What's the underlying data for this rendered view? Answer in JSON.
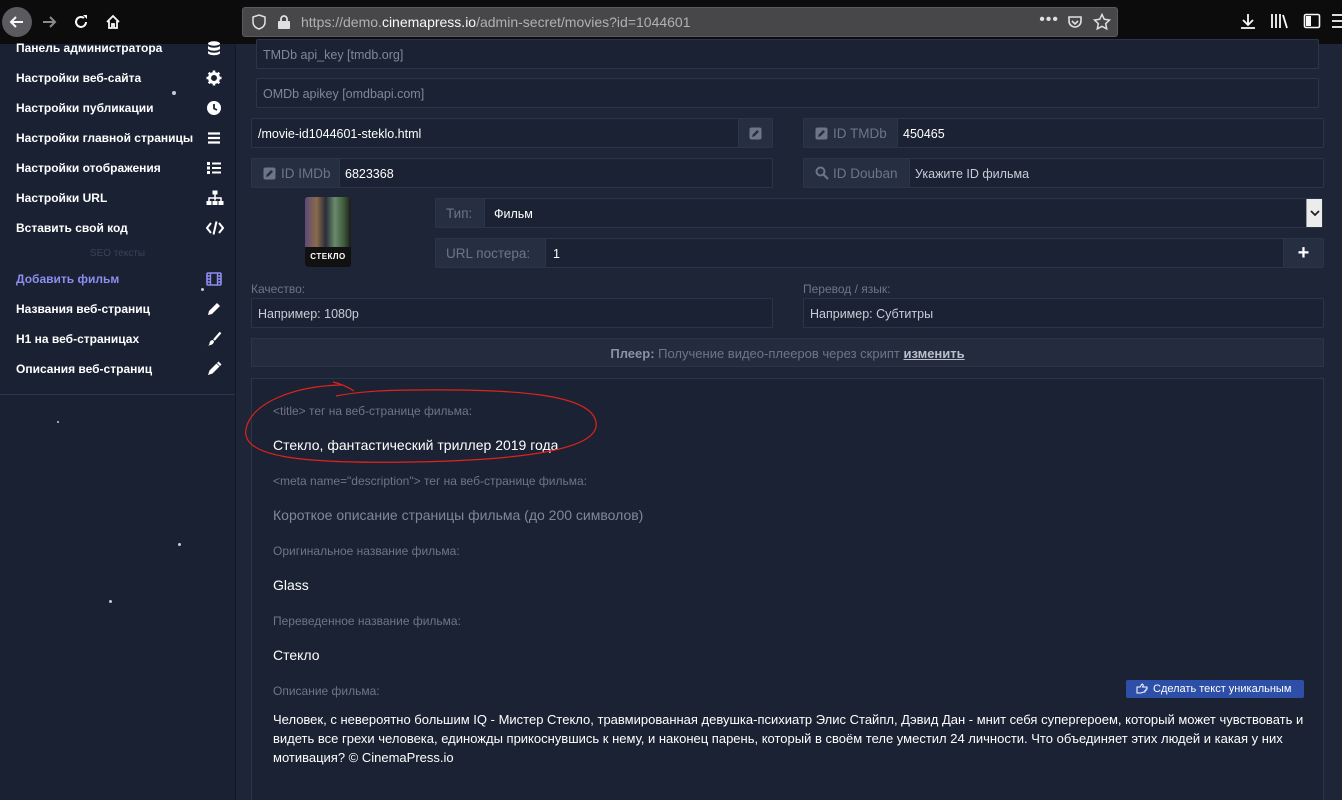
{
  "browser": {
    "url_prefix": "https://demo.",
    "url_host": "cinemapress.io",
    "url_path": "/admin-secret/movies?id=1044601",
    "menu_dots": "•••"
  },
  "sidebar": {
    "items_top": [
      {
        "label": "Панель администратора",
        "icon": "database-icon"
      },
      {
        "label": "Настройки веб-сайта",
        "icon": "gear-icon"
      },
      {
        "label": "Настройки публикации",
        "icon": "clock-icon"
      },
      {
        "label": "Настройки главной страницы",
        "icon": "list-icon"
      },
      {
        "label": "Настройки отображения",
        "icon": "list-bullets-icon"
      },
      {
        "label": "Настройки URL",
        "icon": "sitemap-icon"
      },
      {
        "label": "Вставить свой код",
        "icon": "code-icon"
      }
    ],
    "section_label": "SEO тексты",
    "items_bottom": [
      {
        "label": "Добавить фильм",
        "icon": "film-icon",
        "active": true
      },
      {
        "label": "Названия веб-страниц",
        "icon": "pencil-icon"
      },
      {
        "label": "H1 на веб-страницах",
        "icon": "brush-icon"
      },
      {
        "label": "Описания веб-страниц",
        "icon": "pen-icon"
      }
    ]
  },
  "form": {
    "tmdb_api_placeholder": "TMDb api_key [tmdb.org]",
    "omdb_api_placeholder": "OMDb apikey [omdbapi.com]",
    "url_value": "/movie-id1044601-steklo.html",
    "id_tmdb_label": "ID TMDb",
    "id_tmdb_value": "450465",
    "id_imdb_label": "ID IMDb",
    "id_imdb_value": "6823368",
    "id_douban_label": "ID Douban",
    "id_douban_placeholder": "Укажите ID фильма",
    "poster_title": "СТЕКЛО",
    "type_label": "Тип:",
    "type_value": "Фильм",
    "poster_url_label": "URL постера:",
    "poster_url_value": "1",
    "add_symbol": "+",
    "quality_label": "Качество:",
    "quality_placeholder": "Например: 1080p",
    "translation_label": "Перевод / язык:",
    "translation_placeholder": "Например: Субтитры",
    "player_bold": "Плеер:",
    "player_text": " Получение видео-плееров через скрипт ",
    "player_link": "изменить"
  },
  "seo": {
    "title_label": "<title> тег на веб-странице фильма:",
    "title_value": "Стекло, фантастический триллер 2019 года",
    "meta_label": "<meta name=\"description\"> тег на веб-странице фильма:",
    "meta_placeholder": "Короткое описание страницы фильма (до 200 символов)",
    "orig_label": "Оригинальное название фильма:",
    "orig_value": "Glass",
    "trans_label": "Переведенное название фильма:",
    "trans_value": "Стекло",
    "desc_label": "Описание фильма:",
    "uniq_button": "Сделать текст уникальным",
    "description": "Человек, с невероятно большим IQ - Мистер Стекло, травмированная девушка-психиатр Элис Стайпл, Дэвид Дан - мнит себя супергероем, который может чувствовать и видеть все грехи человека, единожды прикоснувшись к нему, и наконец парень, который в своём теле уместил 24 личности. Что объединяет этих людей и какая у них мотивация? © CinemaPress.io"
  },
  "colors": {
    "background": "#1e2537",
    "sidebar": "#1a2133",
    "active_item": "#8d8df0",
    "button_blue": "#2d4fa8",
    "annotation_red": "#e0231c"
  }
}
